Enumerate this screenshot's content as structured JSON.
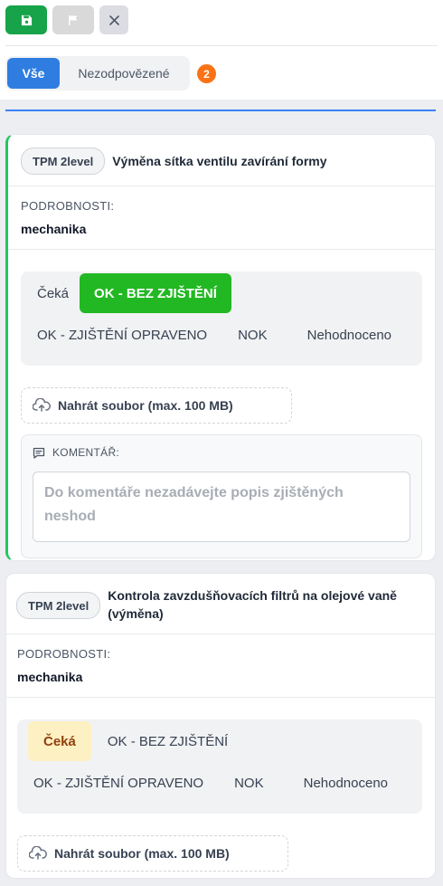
{
  "toolbar": {
    "save_icon": "save-icon",
    "flag_icon": "flag-icon",
    "close_icon": "close-icon"
  },
  "filters": {
    "tabs": [
      {
        "label": "Vše",
        "active": true
      },
      {
        "label": "Nezodpovězené",
        "active": false
      }
    ],
    "unanswered_count": "2"
  },
  "colors": {
    "primary": "#2f7de1",
    "success": "#22b823",
    "save": "#16a34a",
    "badge": "#f97316",
    "pending": "#fdf0c2"
  },
  "cards": [
    {
      "level": "TPM 2level",
      "title": "Výměna sítka ventilu zavírání formy",
      "details_label": "PODROBNOSTI:",
      "details_value": "mechanika",
      "status_options": [
        "Čeká",
        "OK - BEZ ZJIŠTĚNÍ",
        "OK - ZJIŠTĚNÍ OPRAVENO",
        "NOK",
        "Nehodnoceno"
      ],
      "selected_status": "OK - BEZ ZJIŠTĚNÍ",
      "upload_label": "Nahrát soubor (max. 100 MB)",
      "comment_label": "KOMENTÁŘ:",
      "comment_placeholder": "Do komentáře nezadávejte popis zjištěných neshod"
    },
    {
      "level": "TPM 2level",
      "title": "Kontrola zavzdušňovacích filtrů na olejové vaně (výměna)",
      "details_label": "PODROBNOSTI:",
      "details_value": "mechanika",
      "status_options": [
        "Čeká",
        "OK - BEZ ZJIŠTĚNÍ",
        "OK - ZJIŠTĚNÍ OPRAVENO",
        "NOK",
        "Nehodnoceno"
      ],
      "selected_status": "Čeká",
      "upload_label": "Nahrát soubor (max. 100 MB)"
    }
  ]
}
